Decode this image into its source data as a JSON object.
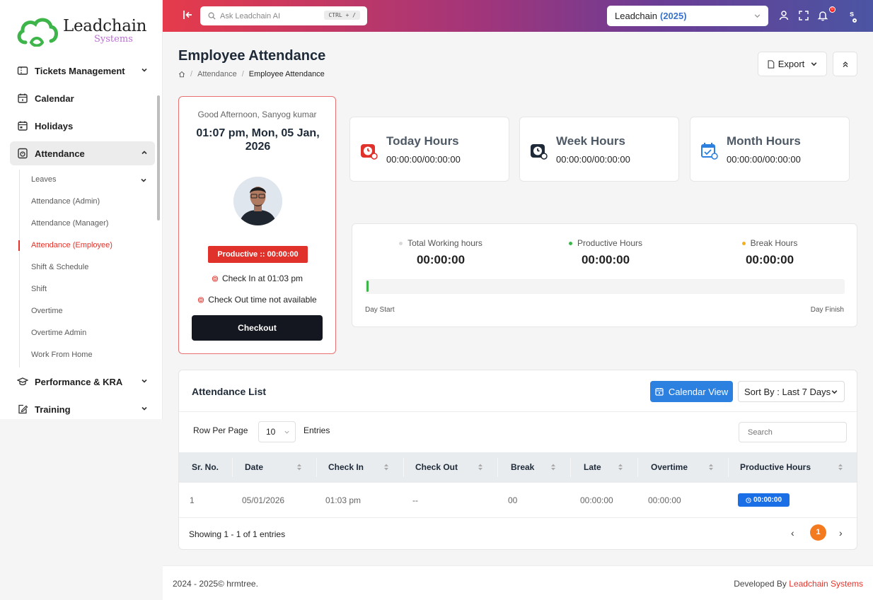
{
  "brand": {
    "name_line1": "Leadchain",
    "name_line2": "Systems"
  },
  "sidebar": {
    "items": [
      {
        "label": "Tickets Management",
        "icon": "ticket-icon",
        "expandable": true
      },
      {
        "label": "Calendar",
        "icon": "calendar-icon"
      },
      {
        "label": "Holidays",
        "icon": "holidays-calendar-icon"
      },
      {
        "label": "Attendance",
        "icon": "attendance-icon",
        "expanded": true,
        "active": true
      },
      {
        "label": "Performance & KRA",
        "icon": "graduation-cap-icon",
        "expandable": true
      },
      {
        "label": "Training",
        "icon": "edit-icon",
        "expandable": true
      }
    ],
    "attendance_submenu": [
      {
        "label": "Leaves",
        "expandable": true
      },
      {
        "label": "Attendance (Admin)"
      },
      {
        "label": "Attendance (Manager)"
      },
      {
        "label": "Attendance (Employee)",
        "active": true
      },
      {
        "label": "Shift & Schedule"
      },
      {
        "label": "Shift"
      },
      {
        "label": "Overtime"
      },
      {
        "label": "Overtime Admin"
      },
      {
        "label": "Work From Home"
      }
    ]
  },
  "header": {
    "search_placeholder": "Ask Leadchain AI",
    "search_shortcut": "CTRL + /",
    "company": "Leadchain",
    "company_year": "(2025)",
    "notification_count": "0",
    "user_initial": "s",
    "gradient_colors": [
      "#e63b4b",
      "#a1357b",
      "#6a3d95",
      "#4b55a3"
    ]
  },
  "page": {
    "title": "Employee Attendance",
    "breadcrumb": [
      "Attendance",
      "Employee Attendance"
    ],
    "export_label": "Export"
  },
  "profile": {
    "greeting": "Good Afternoon, Sanyog kumar",
    "datetime": "01:07 pm, Mon, 05 Jan, 2026",
    "productive_badge": "Productive :: 00:00:00",
    "check_in": "Check In at 01:03 pm",
    "check_out": "Check Out time not available",
    "checkout_button": "Checkout"
  },
  "hours": [
    {
      "label": "Today Hours",
      "value": "00:00:00/00:00:00",
      "icon": "clock-alert-icon",
      "color": "#e0312b"
    },
    {
      "label": "Week Hours",
      "value": "00:00:00/00:00:00",
      "icon": "clock-icon",
      "color": "#1e2a38"
    },
    {
      "label": "Month Hours",
      "value": "00:00:00/00:00:00",
      "icon": "calendar-check-icon",
      "color": "#2b80e0"
    }
  ],
  "summary": {
    "total": {
      "label": "Total Working hours",
      "value": "00:00:00",
      "color": "#d8d8d8"
    },
    "productive": {
      "label": "Productive Hours",
      "value": "00:00:00",
      "color": "#3eb54a"
    },
    "break": {
      "label": "Break Hours",
      "value": "00:00:00",
      "color": "#f2b01e"
    },
    "day_start": "Day Start",
    "day_finish": "Day Finish"
  },
  "attendance_list": {
    "title": "Attendance List",
    "calendar_view_label": "Calendar View",
    "sort_label": "Sort By : Last 7 Days",
    "rows_per_page_label": "Row Per Page",
    "rows_per_page_value": "10",
    "entries_label": "Entries",
    "search_placeholder": "Search",
    "columns": [
      "Sr. No.",
      "Date",
      "Check In",
      "Check Out",
      "Break",
      "Late",
      "Overtime",
      "Productive Hours"
    ],
    "rows": [
      {
        "sr": "1",
        "date": "05/01/2026",
        "check_in": "01:03 pm",
        "check_out": "--",
        "break": "00",
        "late": "00:00:00",
        "overtime": "00:00:00",
        "productive": "00:00:00"
      }
    ],
    "showing": "Showing 1 - 1 of 1 entries",
    "current_page": "1",
    "prev": "‹",
    "next": "›"
  },
  "footer": {
    "copyright": "2024 - 2025© hrmtree.",
    "developed_by": "Developed By",
    "developer": "Leadchain Systems"
  }
}
